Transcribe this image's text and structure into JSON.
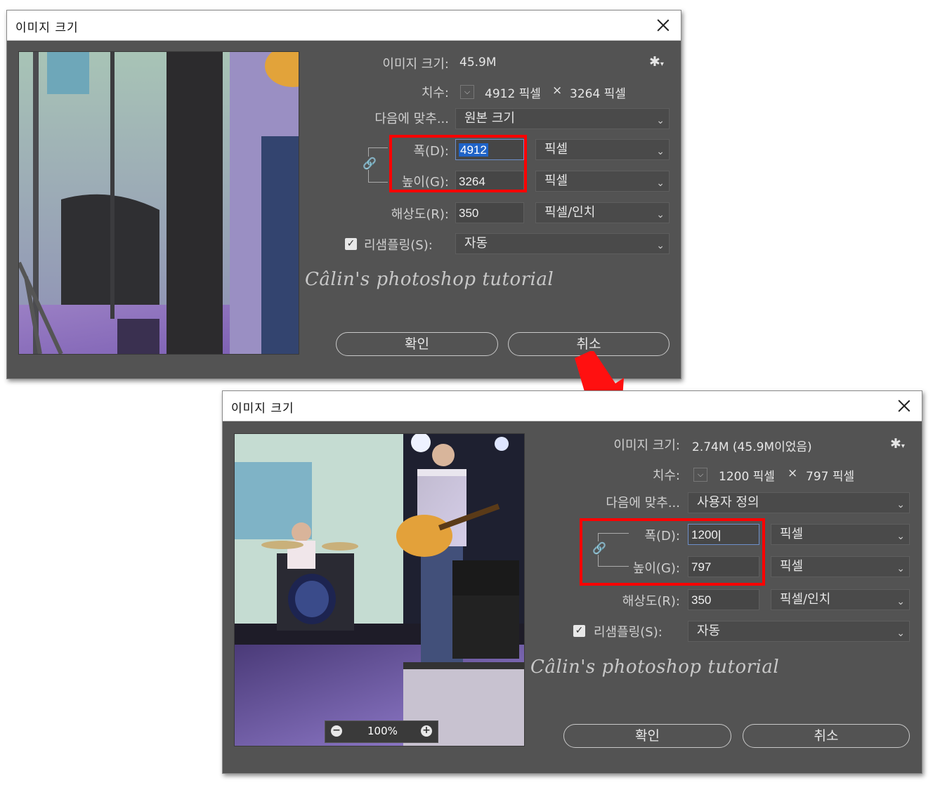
{
  "dialog1": {
    "title": "이미지 크기",
    "image_size_label": "이미지 크기:",
    "image_size_value": "45.9M",
    "dimensions_label": "치수:",
    "dimensions_width": "4912 픽셀",
    "dimensions_x": "×",
    "dimensions_height": "3264 픽셀",
    "fit_to_label": "다음에 맞추...",
    "fit_to_value": "원본 크기",
    "width_label": "폭(D):",
    "width_value": "4912",
    "width_unit": "픽셀",
    "height_label": "높이(G):",
    "height_value": "3264",
    "height_unit": "픽셀",
    "resolution_label": "해상도(R):",
    "resolution_value": "350",
    "resolution_unit": "픽셀/인치",
    "resample_label": "리샘플링(S):",
    "resample_value": "자동",
    "resample_checked": true,
    "ok_label": "확인",
    "cancel_label": "취소"
  },
  "dialog2": {
    "title": "이미지 크기",
    "image_size_label": "이미지 크기:",
    "image_size_value": "2.74M (45.9M이었음)",
    "dimensions_label": "치수:",
    "dimensions_width": "1200 픽셀",
    "dimensions_x": "×",
    "dimensions_height": "797 픽셀",
    "fit_to_label": "다음에 맞추...",
    "fit_to_value": "사용자 정의",
    "width_label": "폭(D):",
    "width_value": "1200",
    "width_unit": "픽셀",
    "height_label": "높이(G):",
    "height_value": "797",
    "height_unit": "픽셀",
    "resolution_label": "해상도(R):",
    "resolution_value": "350",
    "resolution_unit": "픽셀/인치",
    "resample_label": "리샘플링(S):",
    "resample_value": "자동",
    "resample_checked": true,
    "zoom_value": "100%",
    "ok_label": "확인",
    "cancel_label": "취소"
  },
  "watermark": "Câlin's photoshop tutorial",
  "icons": {
    "close": "close-icon",
    "settings": "gear-icon",
    "link": "chain-link-icon",
    "arrow": "red-arrow-icon",
    "dropdown": "chevron-down-icon"
  },
  "colors": {
    "dialog_bg": "#535353",
    "highlight_red": "#ff0000",
    "selection_blue": "#1f63c7"
  }
}
